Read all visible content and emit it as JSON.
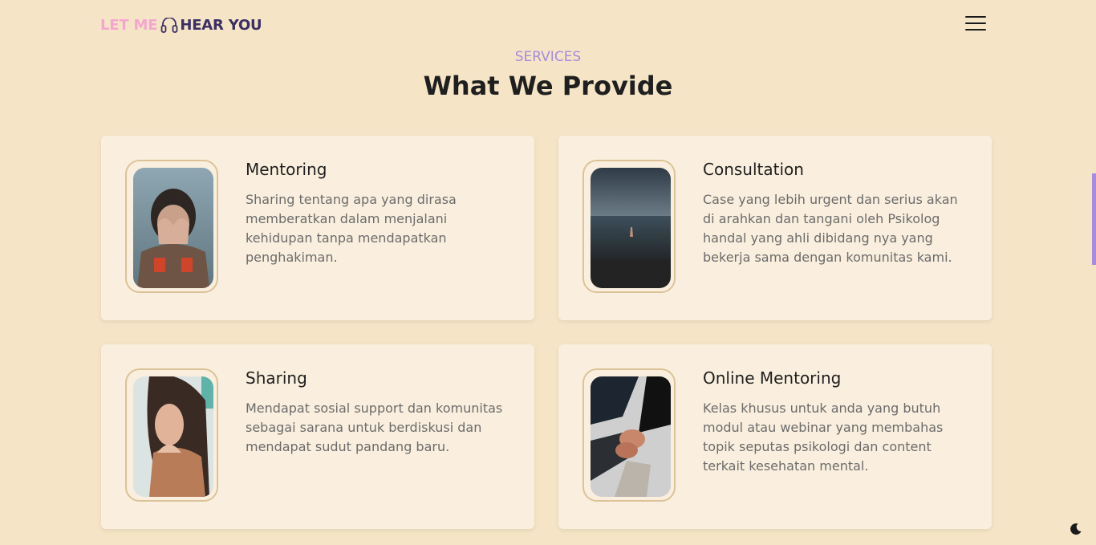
{
  "header": {
    "logo": {
      "part1": "LET ME",
      "part2": "HEAR YOU",
      "icon": "headphones-icon"
    },
    "menu_icon": "hamburger-menu-icon"
  },
  "section": {
    "subtitle": "SERVICES",
    "title": "What We Provide"
  },
  "services": [
    {
      "title": "Mentoring",
      "description": "Sharing tentang apa yang dirasa memberatkan dalam menjalani kehidupan tanpa mendapatkan penghakiman."
    },
    {
      "title": "Consultation",
      "description": "Case yang lebih urgent dan serius akan di arahkan dan tangani oleh Psikolog handal yang ahli dibidang nya yang bekerja sama dengan komunitas kami."
    },
    {
      "title": "Sharing",
      "description": "Mendapat sosial support dan komunitas sebagai sarana untuk berdiskusi dan mendapat sudut pandang baru."
    },
    {
      "title": "Online Mentoring",
      "description": "Kelas khusus untuk anda yang butuh modul atau webinar yang membahas topik seputas psikologi dan content terkait kesehatan mental."
    }
  ],
  "theme_toggle_icon": "moon-icon",
  "colors": {
    "background": "#F5E5C6",
    "card": "#FAEFDE",
    "accent": "#A78BDE",
    "logo_pink": "#F4A6CF",
    "logo_dark": "#3B2F63",
    "frame_border": "#DCC397"
  }
}
